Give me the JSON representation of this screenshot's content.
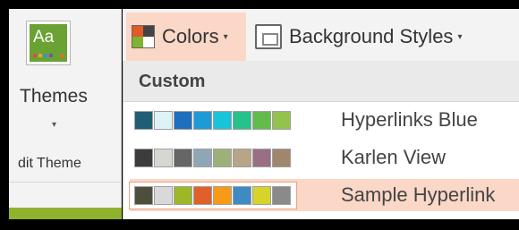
{
  "left_panel": {
    "themes_label": "Themes",
    "themes_thumb_text": "Aa",
    "themes_thumb_bar_colors": [
      "#e04b4b",
      "#f0a030",
      "#3a8fd8",
      "#7b4fb8",
      "#6aa233",
      "#e07030"
    ],
    "group_label": "dit Theme",
    "caret": "▾"
  },
  "ribbon": {
    "colors_label": "Colors",
    "colors_icon_colors": [
      "#e05a2a",
      "#444444",
      "#7fb52e",
      "#ffffff"
    ],
    "colors_caret": "▾",
    "background_label": "Background Styles",
    "background_caret": "▾"
  },
  "dropdown": {
    "header": "Custom",
    "schemes": [
      {
        "name": "Hyperlinks Blue",
        "selected": false,
        "swatches": [
          "#1f5e74",
          "#dff3f6",
          "#1f6fbf",
          "#1e9ad6",
          "#18c4d8",
          "#26c28b",
          "#62bb4a",
          "#93c24d"
        ]
      },
      {
        "name": "Karlen View",
        "selected": false,
        "swatches": [
          "#3c3c3c",
          "#d8d6d0",
          "#666666",
          "#8fa6b5",
          "#9eb07a",
          "#b8a486",
          "#9a6f84",
          "#a0866d"
        ]
      },
      {
        "name": "Sample Hyperlink",
        "selected": true,
        "swatches": [
          "#4e4e3c",
          "#d9d9d9",
          "#9db827",
          "#e0602a",
          "#f99a17",
          "#3e8bc3",
          "#d6d42a",
          "#8a8a8a"
        ]
      }
    ]
  }
}
